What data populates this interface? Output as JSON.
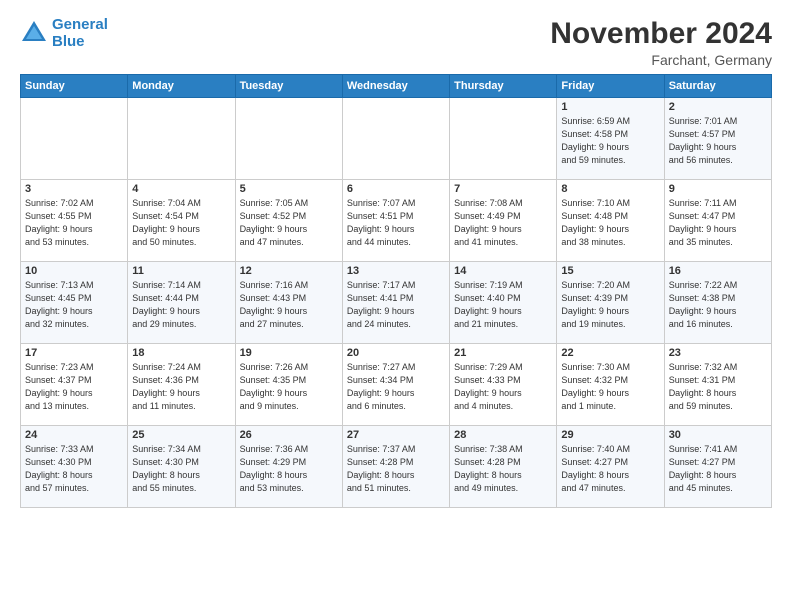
{
  "logo": {
    "line1": "General",
    "line2": "Blue"
  },
  "title": "November 2024",
  "location": "Farchant, Germany",
  "days_of_week": [
    "Sunday",
    "Monday",
    "Tuesday",
    "Wednesday",
    "Thursday",
    "Friday",
    "Saturday"
  ],
  "weeks": [
    [
      {
        "day": "",
        "info": ""
      },
      {
        "day": "",
        "info": ""
      },
      {
        "day": "",
        "info": ""
      },
      {
        "day": "",
        "info": ""
      },
      {
        "day": "",
        "info": ""
      },
      {
        "day": "1",
        "info": "Sunrise: 6:59 AM\nSunset: 4:58 PM\nDaylight: 9 hours\nand 59 minutes."
      },
      {
        "day": "2",
        "info": "Sunrise: 7:01 AM\nSunset: 4:57 PM\nDaylight: 9 hours\nand 56 minutes."
      }
    ],
    [
      {
        "day": "3",
        "info": "Sunrise: 7:02 AM\nSunset: 4:55 PM\nDaylight: 9 hours\nand 53 minutes."
      },
      {
        "day": "4",
        "info": "Sunrise: 7:04 AM\nSunset: 4:54 PM\nDaylight: 9 hours\nand 50 minutes."
      },
      {
        "day": "5",
        "info": "Sunrise: 7:05 AM\nSunset: 4:52 PM\nDaylight: 9 hours\nand 47 minutes."
      },
      {
        "day": "6",
        "info": "Sunrise: 7:07 AM\nSunset: 4:51 PM\nDaylight: 9 hours\nand 44 minutes."
      },
      {
        "day": "7",
        "info": "Sunrise: 7:08 AM\nSunset: 4:49 PM\nDaylight: 9 hours\nand 41 minutes."
      },
      {
        "day": "8",
        "info": "Sunrise: 7:10 AM\nSunset: 4:48 PM\nDaylight: 9 hours\nand 38 minutes."
      },
      {
        "day": "9",
        "info": "Sunrise: 7:11 AM\nSunset: 4:47 PM\nDaylight: 9 hours\nand 35 minutes."
      }
    ],
    [
      {
        "day": "10",
        "info": "Sunrise: 7:13 AM\nSunset: 4:45 PM\nDaylight: 9 hours\nand 32 minutes."
      },
      {
        "day": "11",
        "info": "Sunrise: 7:14 AM\nSunset: 4:44 PM\nDaylight: 9 hours\nand 29 minutes."
      },
      {
        "day": "12",
        "info": "Sunrise: 7:16 AM\nSunset: 4:43 PM\nDaylight: 9 hours\nand 27 minutes."
      },
      {
        "day": "13",
        "info": "Sunrise: 7:17 AM\nSunset: 4:41 PM\nDaylight: 9 hours\nand 24 minutes."
      },
      {
        "day": "14",
        "info": "Sunrise: 7:19 AM\nSunset: 4:40 PM\nDaylight: 9 hours\nand 21 minutes."
      },
      {
        "day": "15",
        "info": "Sunrise: 7:20 AM\nSunset: 4:39 PM\nDaylight: 9 hours\nand 19 minutes."
      },
      {
        "day": "16",
        "info": "Sunrise: 7:22 AM\nSunset: 4:38 PM\nDaylight: 9 hours\nand 16 minutes."
      }
    ],
    [
      {
        "day": "17",
        "info": "Sunrise: 7:23 AM\nSunset: 4:37 PM\nDaylight: 9 hours\nand 13 minutes."
      },
      {
        "day": "18",
        "info": "Sunrise: 7:24 AM\nSunset: 4:36 PM\nDaylight: 9 hours\nand 11 minutes."
      },
      {
        "day": "19",
        "info": "Sunrise: 7:26 AM\nSunset: 4:35 PM\nDaylight: 9 hours\nand 9 minutes."
      },
      {
        "day": "20",
        "info": "Sunrise: 7:27 AM\nSunset: 4:34 PM\nDaylight: 9 hours\nand 6 minutes."
      },
      {
        "day": "21",
        "info": "Sunrise: 7:29 AM\nSunset: 4:33 PM\nDaylight: 9 hours\nand 4 minutes."
      },
      {
        "day": "22",
        "info": "Sunrise: 7:30 AM\nSunset: 4:32 PM\nDaylight: 9 hours\nand 1 minute."
      },
      {
        "day": "23",
        "info": "Sunrise: 7:32 AM\nSunset: 4:31 PM\nDaylight: 8 hours\nand 59 minutes."
      }
    ],
    [
      {
        "day": "24",
        "info": "Sunrise: 7:33 AM\nSunset: 4:30 PM\nDaylight: 8 hours\nand 57 minutes."
      },
      {
        "day": "25",
        "info": "Sunrise: 7:34 AM\nSunset: 4:30 PM\nDaylight: 8 hours\nand 55 minutes."
      },
      {
        "day": "26",
        "info": "Sunrise: 7:36 AM\nSunset: 4:29 PM\nDaylight: 8 hours\nand 53 minutes."
      },
      {
        "day": "27",
        "info": "Sunrise: 7:37 AM\nSunset: 4:28 PM\nDaylight: 8 hours\nand 51 minutes."
      },
      {
        "day": "28",
        "info": "Sunrise: 7:38 AM\nSunset: 4:28 PM\nDaylight: 8 hours\nand 49 minutes."
      },
      {
        "day": "29",
        "info": "Sunrise: 7:40 AM\nSunset: 4:27 PM\nDaylight: 8 hours\nand 47 minutes."
      },
      {
        "day": "30",
        "info": "Sunrise: 7:41 AM\nSunset: 4:27 PM\nDaylight: 8 hours\nand 45 minutes."
      }
    ]
  ]
}
